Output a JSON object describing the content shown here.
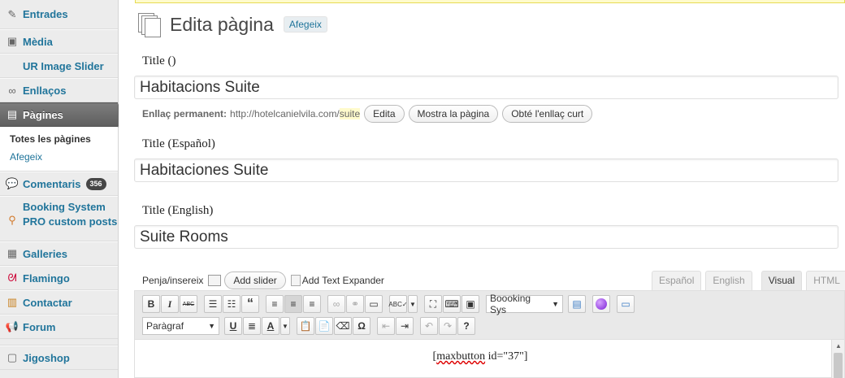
{
  "sidebar": {
    "items": [
      {
        "label": "Entrades",
        "icon": "pin-icon"
      },
      {
        "label": "Mèdia",
        "icon": "media-icon"
      },
      {
        "label": "UR Image Slider",
        "icon": ""
      },
      {
        "label": "Enllaços",
        "icon": "link-icon"
      },
      {
        "label": "Pàgines",
        "icon": "pages-icon"
      },
      {
        "label": "Comentaris",
        "icon": "comment-icon",
        "badge": "356"
      },
      {
        "label": "Booking System PRO custom posts",
        "icon": "magnifier-icon"
      },
      {
        "label": "Galleries",
        "icon": "gallery-icon"
      },
      {
        "label": "Flamingo",
        "icon": "flamingo-icon"
      },
      {
        "label": "Contactar",
        "icon": "contact-icon"
      },
      {
        "label": "Forum",
        "icon": "megaphone-icon"
      },
      {
        "label": "Jigoshop",
        "icon": "shop-icon"
      }
    ],
    "submenu": [
      "Totes les pàgines",
      "Afegeix"
    ]
  },
  "header": {
    "title": "Edita pàgina",
    "add_new": "Afegeix"
  },
  "fields": [
    {
      "label": "Title ()",
      "value": "Habitacions Suite"
    },
    {
      "label": "Title (Español)",
      "value": "Habitaciones Suite"
    },
    {
      "label": "Title (English)",
      "value": "Suite Rooms"
    }
  ],
  "permalink": {
    "label": "Enllaç permanent:",
    "url": "http://hotelcanielvila.com/",
    "slug": "suite",
    "edit_button": "Edita",
    "view_button": "Mostra la pàgina",
    "shortlink_button": "Obté l'enllaç curt"
  },
  "media": {
    "label": "Penja/insereix",
    "add_slider": "Add slider",
    "add_text_expander": "Add Text Expander"
  },
  "tabs": [
    "Español",
    "English",
    "Visual",
    "HTML"
  ],
  "toolbar": {
    "booking_select": "Boooking Sys",
    "format_select": "Paràgraf"
  },
  "editor": {
    "content_prefix": "[",
    "content_word": "maxbutton",
    "content_suffix": " id=\"37\"]"
  },
  "colors": {
    "link": "#21759b",
    "current_menu": "#6d6d6d",
    "notice_border": "#e6db55"
  }
}
